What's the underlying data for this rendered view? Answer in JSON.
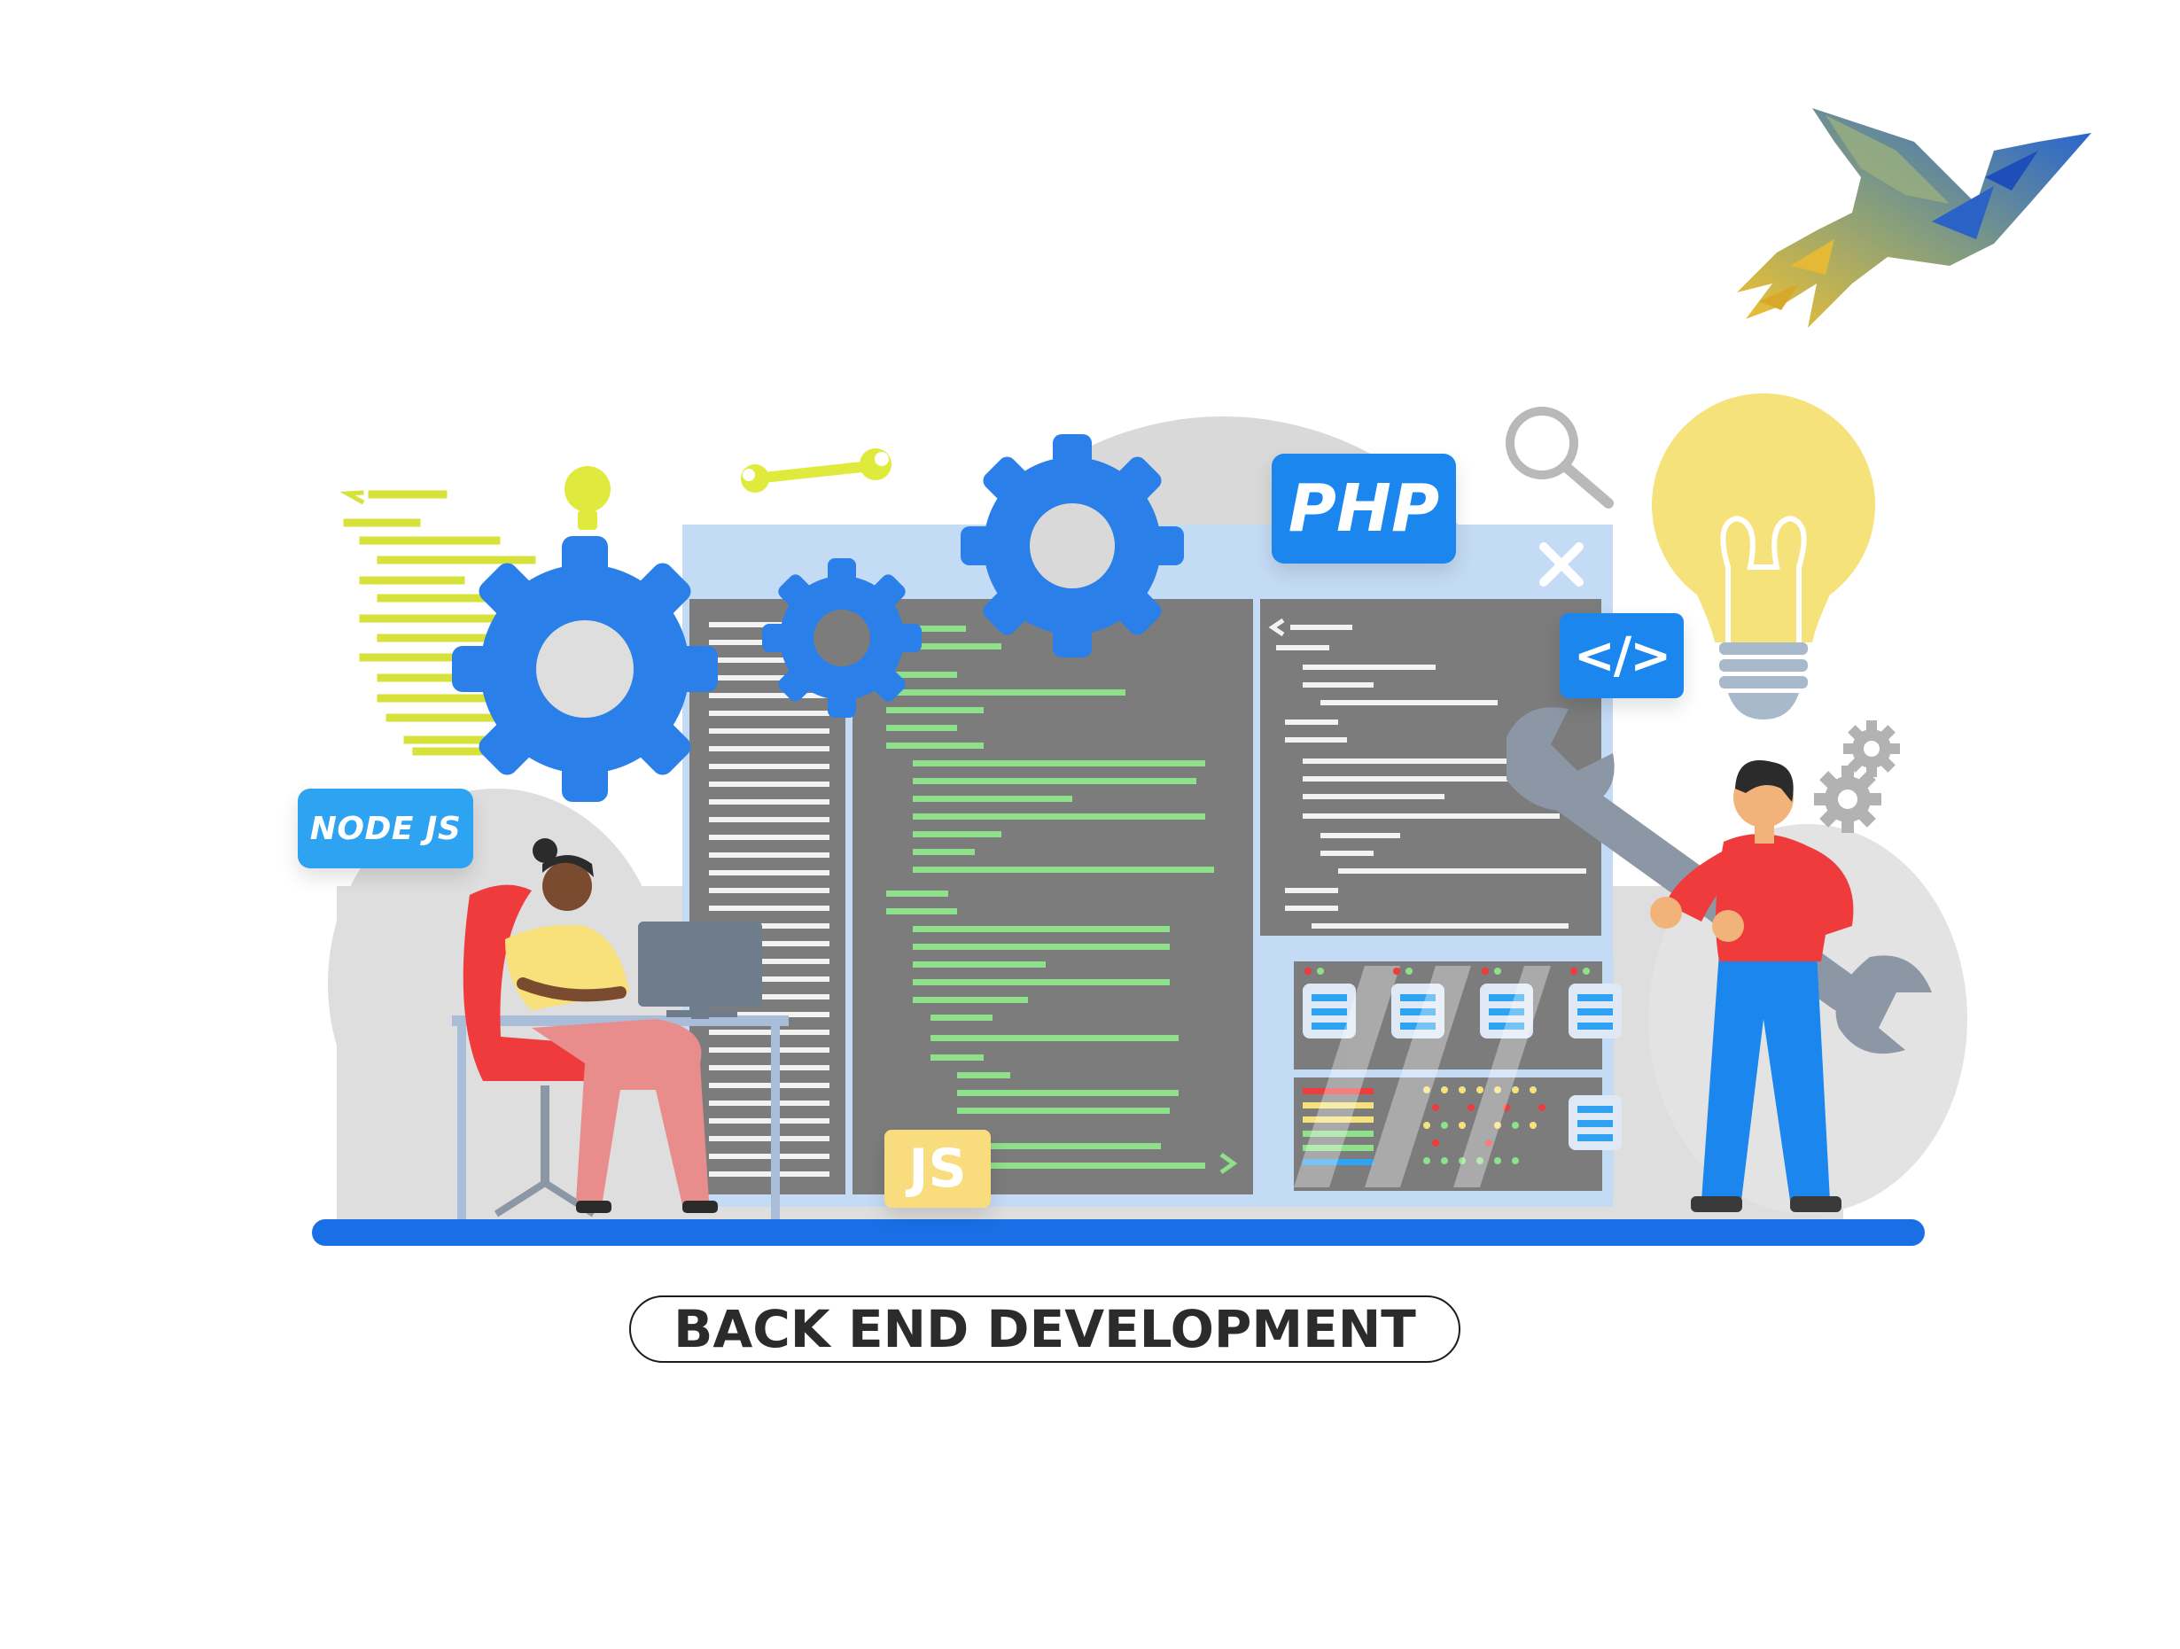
{
  "labels": {
    "node": "NODE JS",
    "php": "PHP",
    "js": "JS",
    "code": "</>",
    "caption": "BACK END DEVELOPMENT"
  },
  "icons": {
    "logo": "hummingbird-logo-icon",
    "gears": "gear-icon",
    "lightbulb": "lightbulb-icon",
    "wrench": "wrench-icon",
    "magnifier": "magnifier-icon",
    "close": "close-icon"
  },
  "colors": {
    "blue_primary": "#1a86ee",
    "gear_blue": "#2a7fe8",
    "panel_gray": "#7a7a7a",
    "code_green": "#8ee08a",
    "code_white": "#f2f2f2",
    "yellow_lines": "#d6e23a",
    "bulb_yellow": "#f5e27a",
    "floor_blue": "#1a6fe6",
    "shirt_red": "#ef3b3b"
  }
}
